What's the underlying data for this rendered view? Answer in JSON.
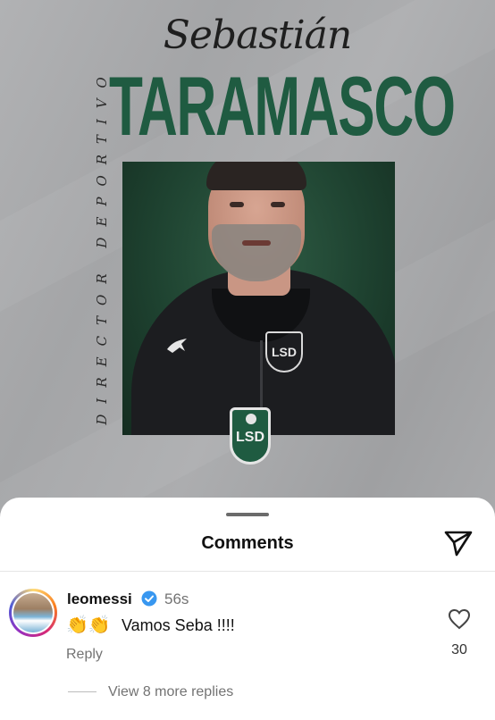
{
  "poster": {
    "first_name": "Sebastián",
    "last_name": "TARAMASCO",
    "role": "DIRECTOR DEPORTIVO",
    "club_badge_text": "LSD",
    "colors": {
      "accent_green": "#1f5b41",
      "background_gray": "#a7a8aa"
    }
  },
  "sheet": {
    "title": "Comments",
    "share_icon": "paper-plane-icon"
  },
  "comment": {
    "username": "leomessi",
    "verified_icon": "verified-badge-icon",
    "time": "56s",
    "emoji": "👏👏",
    "text": "Vamos Seba !!!!",
    "reply_label": "Reply",
    "like_icon": "heart-outline-icon",
    "like_count": "30",
    "view_replies_label": "View 8 more replies"
  }
}
